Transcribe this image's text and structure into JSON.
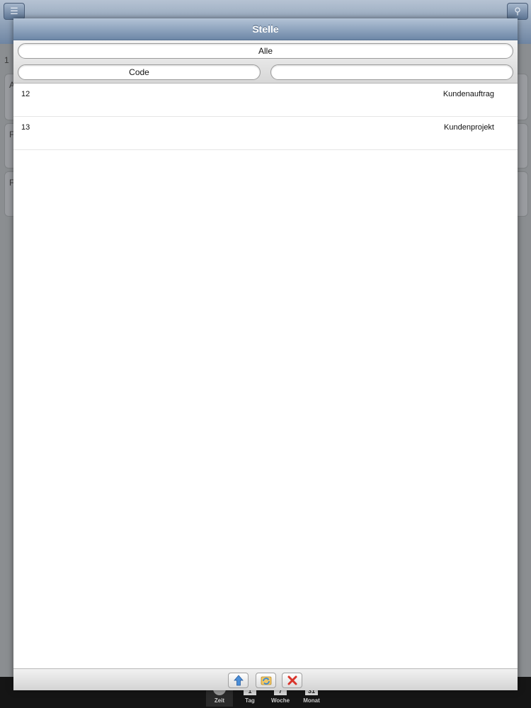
{
  "background_tabbar": {
    "tabs": [
      {
        "label": "Zeit",
        "icon": "clock-icon"
      },
      {
        "label": "Tag",
        "icon": "calendar-day-icon",
        "number": "1"
      },
      {
        "label": "Woche",
        "icon": "calendar-week-icon",
        "number": "7"
      },
      {
        "label": "Monat",
        "icon": "calendar-month-icon",
        "number": "31"
      }
    ],
    "active_tab": "Zeit"
  },
  "background_labels": {
    "row1": "1",
    "card1": "A",
    "card2": "F",
    "card3": "F"
  },
  "modal": {
    "title": "Stelle",
    "filter_all": "Alle",
    "column_code": "Code",
    "column_description": "",
    "rows": [
      {
        "code": "12",
        "description": "Kundenauftrag"
      },
      {
        "code": "13",
        "description": "Kundenprojekt"
      }
    ],
    "footer_buttons": [
      {
        "icon": "up-arrow-icon",
        "color": "#4a8ed8"
      },
      {
        "icon": "refresh-icon",
        "color": "#3b8bd4"
      },
      {
        "icon": "close-icon",
        "color": "#d9342b"
      }
    ]
  }
}
